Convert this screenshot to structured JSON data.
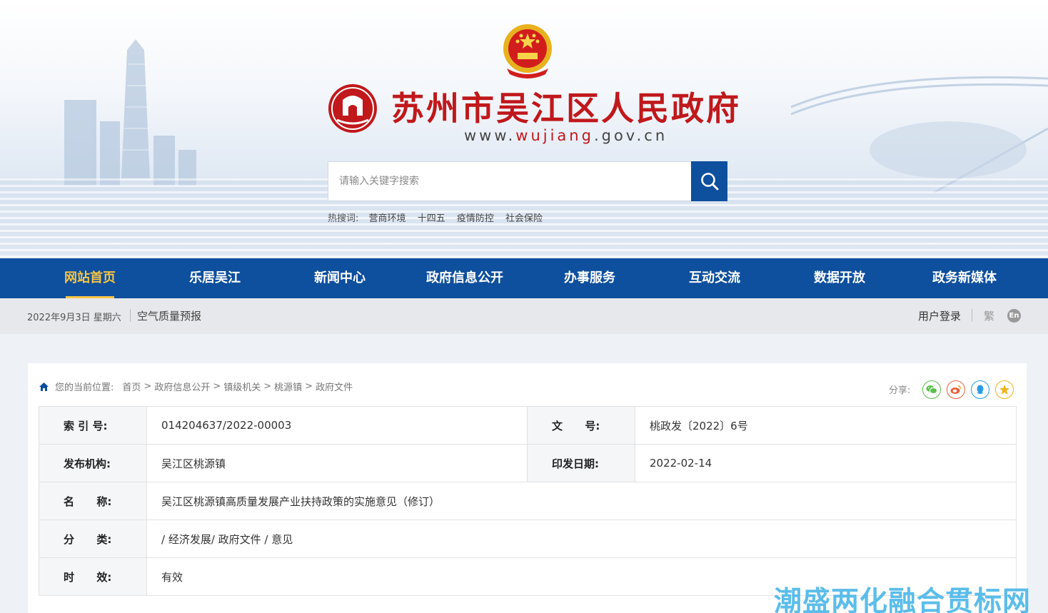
{
  "header": {
    "site_title": "苏州市吴江区人民政府",
    "url_prefix": "www.",
    "url_highlight": "wujiang",
    "url_suffix": ".gov.cn",
    "search_placeholder": "请输入关键字搜索",
    "hot_label": "热搜词:",
    "hot_words": [
      "营商环境",
      "十四五",
      "疫情防控",
      "社会保险"
    ],
    "brand_red": "#c0181b",
    "brand_blue": "#0e4f9e"
  },
  "nav": {
    "items": [
      "网站首页",
      "乐居吴江",
      "新闻中心",
      "政府信息公开",
      "办事服务",
      "互动交流",
      "数据开放",
      "政务新媒体"
    ],
    "active_index": 0,
    "active_color": "#f7c544"
  },
  "infobar": {
    "date": "2022年9月3日 星期六",
    "air_quality": "空气质量预报",
    "login": "用户登录",
    "traditional": "繁",
    "english": "En"
  },
  "breadcrumb": {
    "location_label": "您的当前位置:",
    "items": [
      "首页",
      "政府信息公开",
      "镇级机关",
      "桃源镇",
      "政府文件"
    ]
  },
  "share": {
    "label": "分享:",
    "icons": [
      "wechat-icon",
      "weibo-icon",
      "qq-icon",
      "qzone-icon"
    ]
  },
  "meta": {
    "index_no_label": "索 引 号:",
    "index_no": "014204637/2022-00003",
    "doc_no_label": "文      号:",
    "doc_no": "桃政发〔2022〕6号",
    "publisher_label": "发布机构:",
    "publisher": "吴江区桃源镇",
    "print_date_label": "印发日期:",
    "print_date": "2022-02-14",
    "name_label": "名      称:",
    "name": "吴江区桃源镇高质量发展产业扶持政策的实施意见（修订）",
    "category_label": "分      类:",
    "category": "/ 经济发展/ 政府文件 / 意见",
    "validity_label": "时      效:",
    "validity": "有效"
  },
  "watermark": "潮盛两化融合贯标网"
}
